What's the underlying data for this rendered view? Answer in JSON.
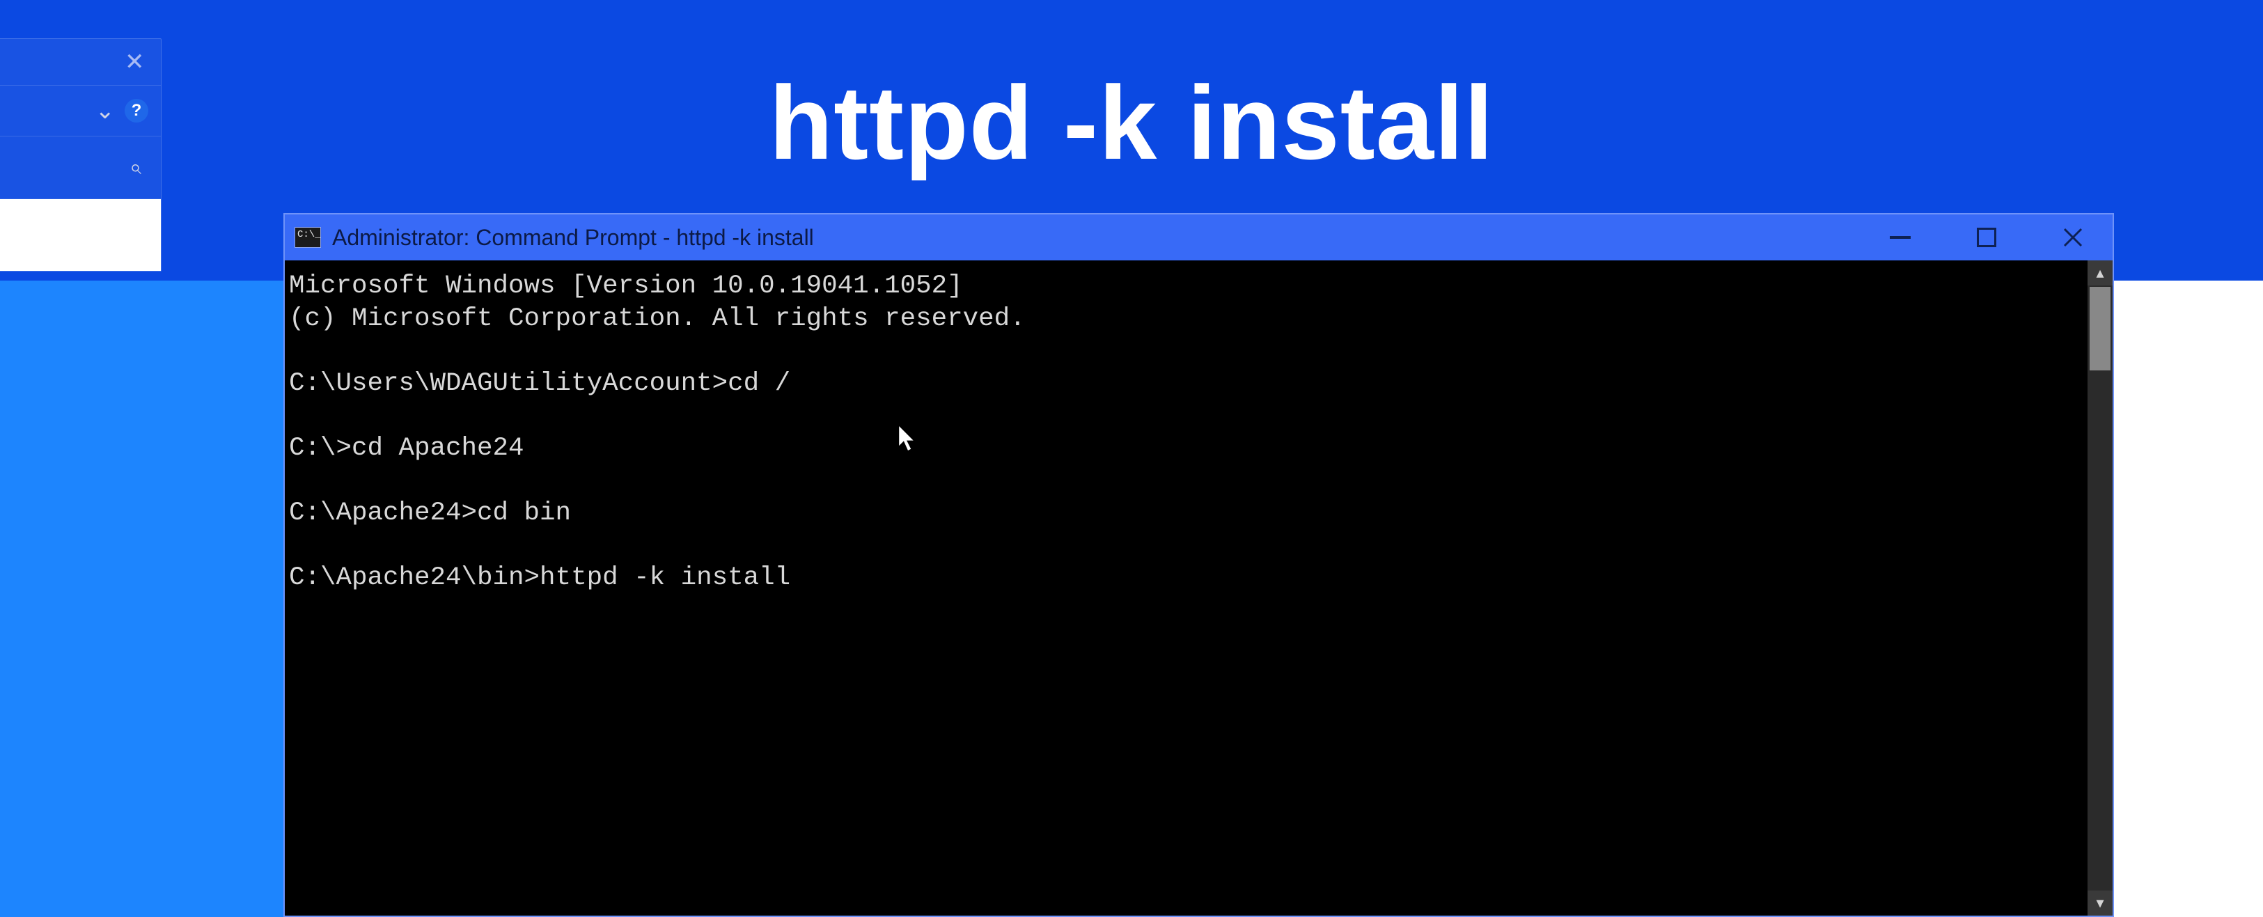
{
  "presentation": {
    "headline": "httpd -k install"
  },
  "background_window": {
    "close_tooltip": "Close",
    "help_glyph": "?",
    "search_glyph": "⌕"
  },
  "cmd_window": {
    "title": "Administrator: Command Prompt - httpd  -k install",
    "terminal_lines": [
      "Microsoft Windows [Version 10.0.19041.1052]",
      "(c) Microsoft Corporation. All rights reserved.",
      "",
      "C:\\Users\\WDAGUtilityAccount>cd /",
      "",
      "C:\\>cd Apache24",
      "",
      "C:\\Apache24>cd bin",
      "",
      "C:\\Apache24\\bin>httpd -k install"
    ]
  }
}
